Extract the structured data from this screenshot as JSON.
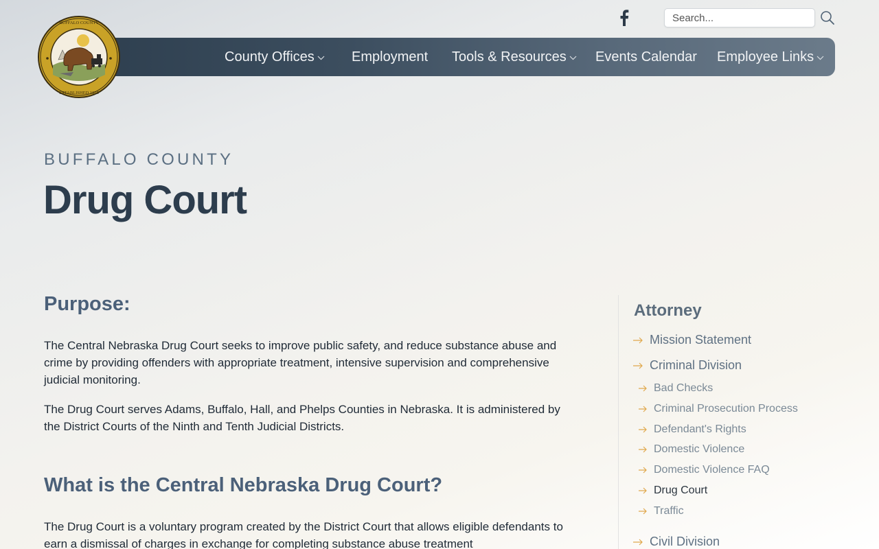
{
  "header": {
    "social_icon": "facebook-icon",
    "search": {
      "placeholder": "Search...",
      "value": ""
    },
    "search_icon": "magnifier-icon",
    "seal_alt": "Buffalo County Nebraska seal",
    "seal_text": "BUFFALO COUNTY, NEBRASKA · ESTABLISHED 1855"
  },
  "nav": {
    "items": [
      {
        "label": "County Offices",
        "dropdown": true
      },
      {
        "label": "Employment",
        "dropdown": false
      },
      {
        "label": "Tools & Resources",
        "dropdown": true
      },
      {
        "label": "Events Calendar",
        "dropdown": false
      },
      {
        "label": "Employee Links",
        "dropdown": true
      }
    ]
  },
  "hero": {
    "eyebrow": "BUFFALO COUNTY",
    "title": "Drug Court"
  },
  "content": {
    "sections": [
      {
        "heading": "Purpose:",
        "paragraphs": [
          "The Central Nebraska Drug Court seeks to improve public safety, and reduce substance abuse and crime by providing offenders with appropriate treatment, intensive supervision and comprehensive judicial monitoring.",
          "The Drug Court serves Adams, Buffalo, Hall, and Phelps Counties in Nebraska. It is administered by the District Courts of the Ninth and Tenth Judicial Districts."
        ]
      },
      {
        "heading": "What is the Central Nebraska Drug Court?",
        "paragraphs": [
          "The Drug Court is a voluntary program created by the District Court that allows eligible defendants to earn a dismissal of charges in exchange for completing substance abuse treatment"
        ]
      }
    ]
  },
  "sidebar": {
    "title": "Attorney",
    "links": [
      {
        "label": "Mission Statement",
        "level": 1
      },
      {
        "label": "Criminal Division",
        "level": 1
      },
      {
        "label": "Bad Checks",
        "level": 2
      },
      {
        "label": "Criminal Prosecution Process",
        "level": 2
      },
      {
        "label": "Defendant's Rights",
        "level": 2
      },
      {
        "label": "Domestic Violence",
        "level": 2
      },
      {
        "label": "Domestic Violence FAQ",
        "level": 2
      },
      {
        "label": "Drug Court",
        "level": 2,
        "active": true
      },
      {
        "label": "Traffic",
        "level": 2
      },
      {
        "label": "Civil Division",
        "level": 1
      }
    ]
  },
  "colors": {
    "nav_dark": "#2e3f4f",
    "nav_light": "#6b7b8a",
    "heading": "#4b6079",
    "title": "#2d3d4d",
    "arrow_accent": "#e0a84c",
    "seal_gold": "#c9a227"
  }
}
